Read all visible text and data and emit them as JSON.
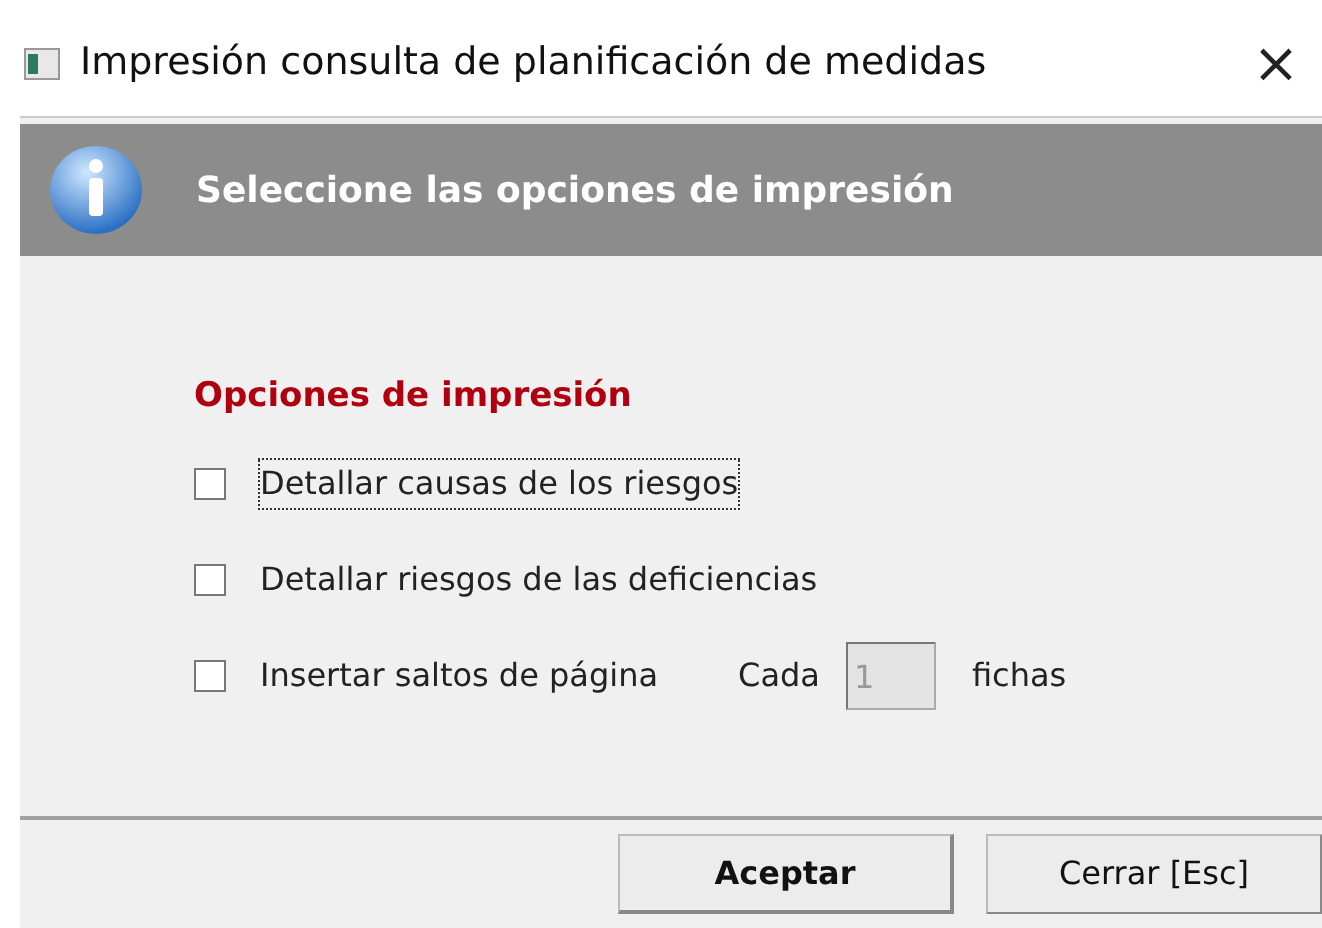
{
  "window": {
    "title": "Impresión consulta de planificación de medidas",
    "close": "×"
  },
  "banner": {
    "text": "Seleccione las opciones de impresión"
  },
  "section": {
    "title": "Opciones de impresión"
  },
  "options": [
    {
      "label": "Detallar causas de los riesgos",
      "checked": false,
      "focused": true
    },
    {
      "label": "Detallar riesgos de las deficiencias",
      "checked": false,
      "focused": false
    },
    {
      "label": "Insertar saltos de página",
      "checked": false,
      "focused": false,
      "extra": {
        "prefix": "Cada",
        "value": "1",
        "suffix": "fichas",
        "disabled": true
      }
    }
  ],
  "buttons": [
    {
      "label": "Aceptar",
      "default": true
    },
    {
      "label": "Cerrar [Esc]",
      "default": false
    }
  ]
}
